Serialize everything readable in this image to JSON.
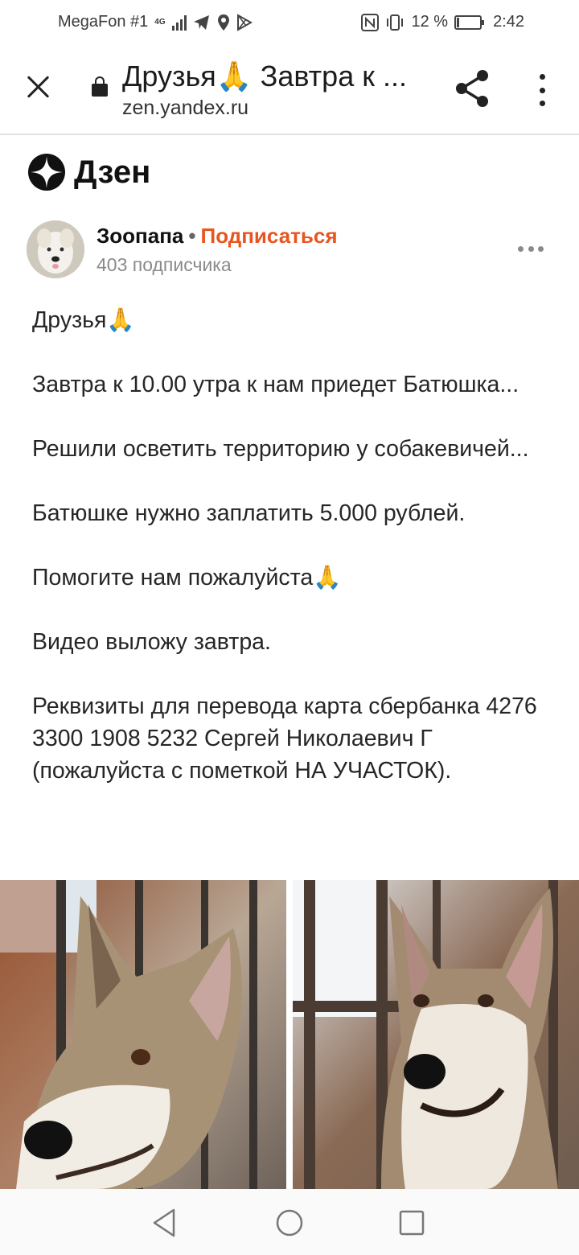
{
  "status_bar": {
    "carrier": "MegaFon #1",
    "network": "4G",
    "battery": "12 %",
    "time": "2:42",
    "battery_level": 0.12
  },
  "browser": {
    "title": "Друзья🙏 Завтра к ...",
    "url": "zen.yandex.ru"
  },
  "app": {
    "logo_text": "Дзен"
  },
  "author": {
    "name": "Зоопапа",
    "separator": "•",
    "subscribe_label": "Подписаться",
    "subscribers": "403 подписчика"
  },
  "article": {
    "paragraphs": [
      "Друзья🙏",
      "Завтра к 10.00 утра к нам приедет Батюшка...",
      "Решили осветить территорию у собакевичей...",
      "Батюшке нужно заплатить 5.000 рублей.",
      "Помогите нам пожалуйста🙏",
      "Видео выложу завтра.",
      "Реквизиты для перевода карта сбербанка 4276 3300 1908 5232 Сергей Николаевич Г (пожалуйста с пометкой НА УЧАСТОК)."
    ]
  },
  "colors": {
    "subscribe": "#e8551f",
    "muted": "#8a8a8a",
    "text": "#262626"
  }
}
